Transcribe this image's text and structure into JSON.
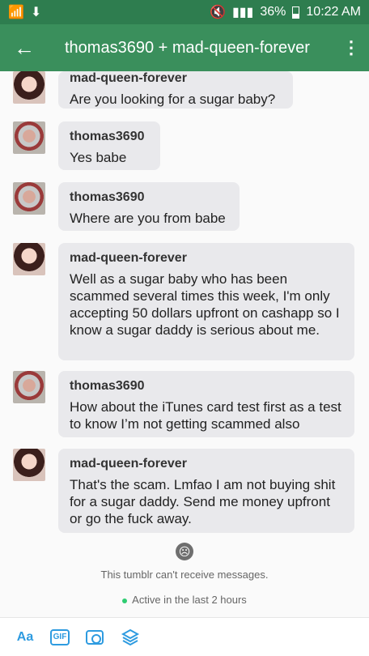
{
  "status_bar": {
    "battery": "36%",
    "time": "10:22 AM"
  },
  "header": {
    "title": "thomas3690 + mad-queen-forever"
  },
  "messages": [
    {
      "user": "mad-queen-forever",
      "avatar": "queen",
      "text": "Are you looking for a sugar baby?"
    },
    {
      "user": "thomas3690",
      "avatar": "thomas",
      "text": "Yes babe"
    },
    {
      "user": "thomas3690",
      "avatar": "thomas",
      "text": "Where are you from babe"
    },
    {
      "user": "mad-queen-forever",
      "avatar": "queen",
      "text": "Well as a sugar baby who has been scammed several times this week, I'm only accepting 50 dollars upfront on cashapp so I know a sugar daddy is serious about me."
    },
    {
      "user": "thomas3690",
      "avatar": "thomas",
      "text": "How about the iTunes card test first as a test to know I’m not getting scammed also"
    },
    {
      "user": "mad-queen-forever",
      "avatar": "queen",
      "text": "That's the scam. Lmfao I am not buying shit for a sugar daddy. Send me money upfront or go the fuck away."
    }
  ],
  "footer": {
    "notice": "This tumblr can't receive messages.",
    "activity": "Active in the last 2 hours"
  },
  "toolbar": {
    "text_label": "Aa",
    "gif_label": "GIF",
    "icons": [
      "text-format-icon",
      "gif-icon",
      "camera-icon",
      "sticker-stack-icon"
    ]
  },
  "colors": {
    "status_bar": "#2e7d4f",
    "header": "#3a8f5c",
    "bubble": "#e9e9ec",
    "toolbar_accent": "#2e9be0",
    "active_dot": "#2ecc71"
  }
}
